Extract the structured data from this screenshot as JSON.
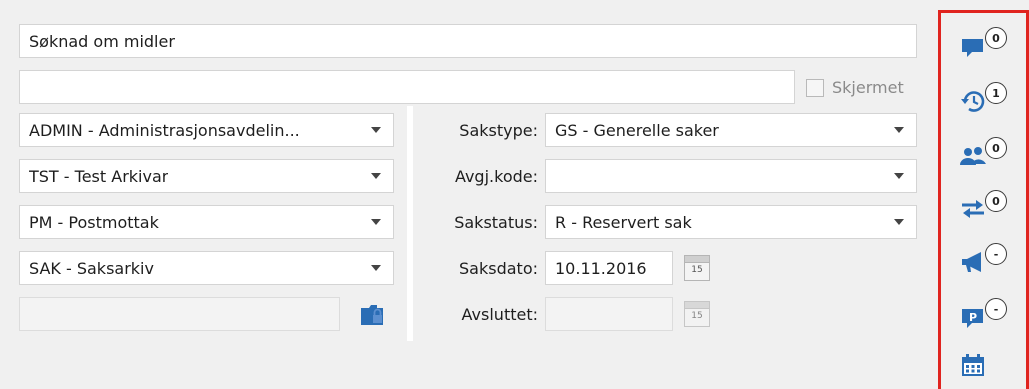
{
  "title_field": {
    "value": "Søknad om midler"
  },
  "subtitle_field": {
    "value": ""
  },
  "skjermet": {
    "label": "Skjermet",
    "checked": false
  },
  "left_column": {
    "fields": [
      {
        "value": "ADMIN - Administrasjonsavdelin..."
      },
      {
        "value": "TST - Test Arkivar"
      },
      {
        "value": "PM - Postmottak"
      },
      {
        "value": "SAK - Saksarkiv"
      }
    ],
    "bottom_field": {
      "value": ""
    }
  },
  "right_column": {
    "sakstype": {
      "label": "Sakstype:",
      "value": "GS - Generelle saker"
    },
    "avgjkode": {
      "label": "Avgj.kode:",
      "value": ""
    },
    "sakstatus": {
      "label": "Sakstatus:",
      "value": "R - Reservert sak"
    },
    "saksdato": {
      "label": "Saksdato:",
      "value": "10.11.2016",
      "calendar_day": "15"
    },
    "avsluttet": {
      "label": "Avsluttet:",
      "value": "",
      "calendar_day": "15"
    }
  },
  "side_panel": {
    "items": [
      {
        "icon": "comment-icon",
        "count": "0"
      },
      {
        "icon": "history-icon",
        "count": "1"
      },
      {
        "icon": "users-icon",
        "count": "0"
      },
      {
        "icon": "transfer-icon",
        "count": "0"
      },
      {
        "icon": "megaphone-icon",
        "count": "-"
      },
      {
        "icon": "parking-icon",
        "count": "-"
      },
      {
        "icon": "calendar-icon"
      }
    ]
  },
  "colors": {
    "accent_blue": "#2a6db5",
    "highlight_red": "#e0241f"
  }
}
